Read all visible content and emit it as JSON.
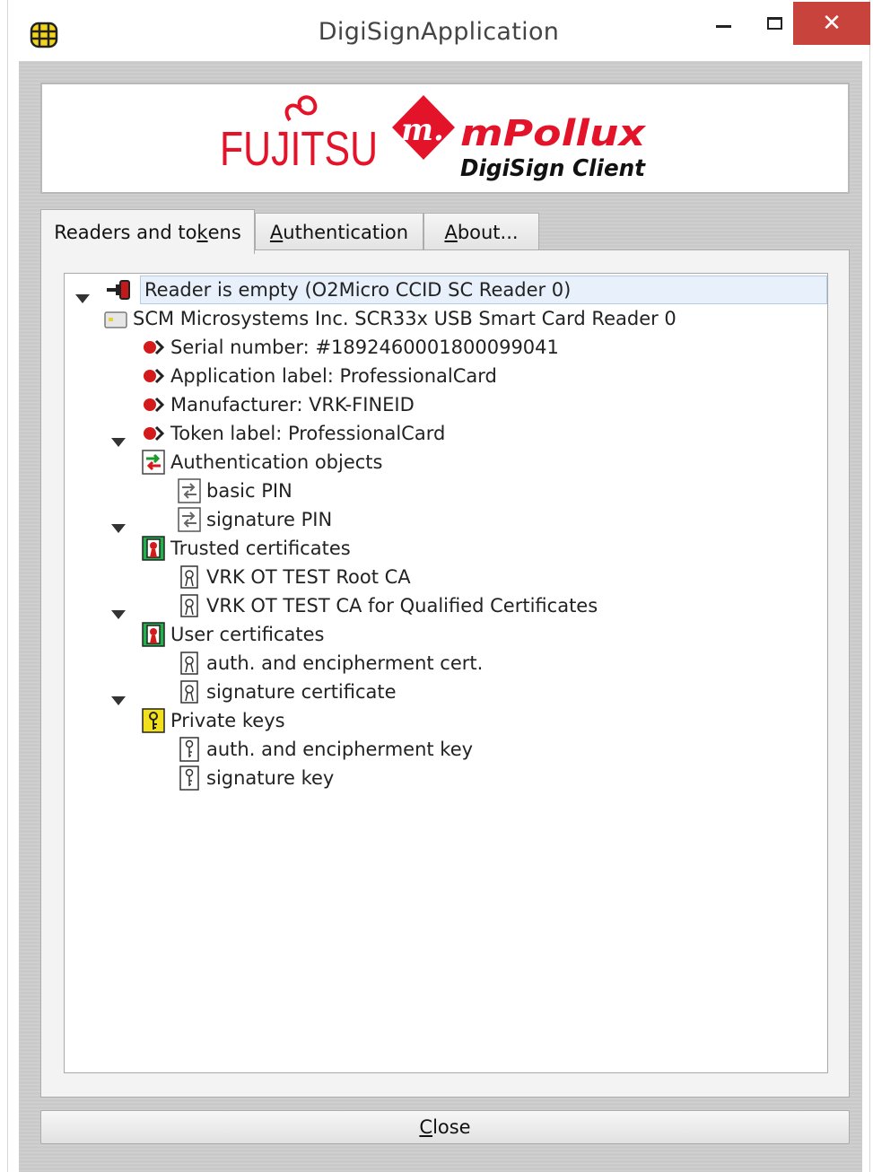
{
  "window": {
    "title": "DigiSignApplication",
    "close_symbol": "✕"
  },
  "banner": {
    "fujitsu_text": "FUJITSU",
    "m_text": "m.",
    "product_text": "mPollux",
    "subtitle_text": "DigiSign Client"
  },
  "tabs": [
    {
      "label_pre": "Readers and to",
      "label_key": "k",
      "label_post": "ens",
      "active": true
    },
    {
      "label_pre": "",
      "label_key": "A",
      "label_post": "uthentication",
      "active": false
    },
    {
      "label_pre": "",
      "label_key": "A",
      "label_post": "bout...",
      "active": false
    }
  ],
  "tree": {
    "reader_empty": {
      "label": "Reader is empty (O2Micro CCID SC Reader 0)",
      "icon": "card-reader-plug-icon",
      "selected": true
    },
    "reader": {
      "label": "SCM Microsystems Inc. SCR33x USB Smart Card Reader 0",
      "icon": "smart-card-icon",
      "expanded": true
    },
    "info": [
      {
        "label": "Serial number: #1892460001800099041",
        "icon": "info-arrow-icon"
      },
      {
        "label": "Application label: ProfessionalCard",
        "icon": "info-arrow-icon"
      },
      {
        "label": "Manufacturer: VRK-FINEID",
        "icon": "info-arrow-icon"
      },
      {
        "label": "Token label: ProfessionalCard",
        "icon": "info-arrow-icon"
      }
    ],
    "auth_objects": {
      "label": "Authentication objects",
      "icon": "auth-objects-icon",
      "children": [
        {
          "label": "basic PIN",
          "icon": "pin-icon"
        },
        {
          "label": "signature PIN",
          "icon": "pin-icon"
        }
      ]
    },
    "trusted_certs": {
      "label": "Trusted certificates",
      "icon": "certificate-folder-icon",
      "children": [
        {
          "label": "VRK OT TEST Root CA",
          "icon": "certificate-icon"
        },
        {
          "label": "VRK OT TEST CA for Qualified Certificates",
          "icon": "certificate-icon"
        }
      ]
    },
    "user_certs": {
      "label": "User certificates",
      "icon": "certificate-folder-icon",
      "children": [
        {
          "label": "auth. and encipherment cert.",
          "icon": "certificate-icon"
        },
        {
          "label": "signature certificate",
          "icon": "certificate-icon"
        }
      ]
    },
    "private_keys": {
      "label": "Private keys",
      "icon": "key-folder-icon",
      "children": [
        {
          "label": "auth. and encipherment key",
          "icon": "key-icon"
        },
        {
          "label": "signature key",
          "icon": "key-icon"
        }
      ]
    }
  },
  "close_button": {
    "key": "C",
    "rest": "lose"
  },
  "colors": {
    "fujitsu_red": "#e3142a",
    "close_red": "#c9433d",
    "tree_selection": "#e8f1fb"
  }
}
